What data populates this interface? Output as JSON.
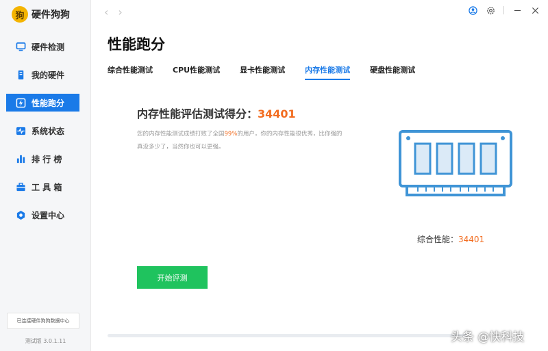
{
  "app": {
    "name": "硬件狗狗",
    "logo_glyph": "狗",
    "status_text": "已连接硬件狗狗数据中心",
    "version": "测试版 3.0.1.11"
  },
  "sidebar": {
    "items": [
      {
        "label": "硬件检测",
        "icon": "monitor-icon",
        "active": false
      },
      {
        "label": "我的硬件",
        "icon": "tower-icon",
        "active": false
      },
      {
        "label": "性能跑分",
        "icon": "lightning-icon",
        "active": true
      },
      {
        "label": "系统状态",
        "icon": "pulse-icon",
        "active": false
      },
      {
        "label": "排 行 榜",
        "icon": "bar-chart-icon",
        "active": false
      },
      {
        "label": "工 具 箱",
        "icon": "toolbox-icon",
        "active": false
      },
      {
        "label": "设置中心",
        "icon": "settings-icon",
        "active": false
      }
    ]
  },
  "topbar": {
    "back_glyph": "‹",
    "forward_glyph": "›",
    "controls": [
      "user-icon",
      "gear-icon",
      "minimize-icon",
      "close-icon"
    ]
  },
  "main": {
    "title": "性能跑分",
    "tabs": [
      {
        "label": "综合性能测试",
        "active": false
      },
      {
        "label": "CPU性能测试",
        "active": false
      },
      {
        "label": "显卡性能测试",
        "active": false
      },
      {
        "label": "内存性能测试",
        "active": true
      },
      {
        "label": "硬盘性能测试",
        "active": false
      }
    ],
    "score_label": "内存性能评估测试得分：",
    "score_value": "34401",
    "desc_pre": "您的内存性能测试成绩打败了全国",
    "desc_pct": "99%",
    "desc_post": "的用户，你的内存性能很优秀，比你强的真没多少了，当然你也可以更强。",
    "overall_label": "综合性能：",
    "overall_value": "34401",
    "start_button": "开始评测",
    "illustration": "memory-module-icon"
  },
  "watermark": "头条 @快科技",
  "colors": {
    "accent": "#1a7ae8",
    "highlight": "#f26d21",
    "start_button": "#1fc35e",
    "ram_illustration": "#3f94d6"
  }
}
